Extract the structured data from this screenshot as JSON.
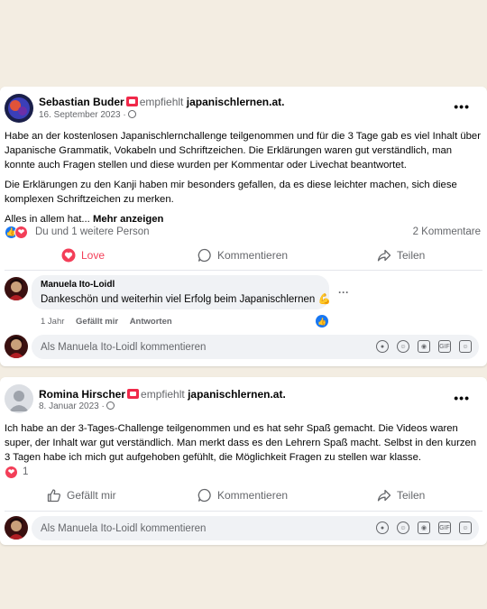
{
  "post1": {
    "author": "Sebastian Buder",
    "recommends": "empfiehlt",
    "page": "japanischlernen.at.",
    "date": "16. September 2023 ·",
    "paragraph1": "Habe an der kostenlosen Japanischlernchallenge teilgenommen und für die 3 Tage gab es viel Inhalt über Japanische Grammatik, Vokabeln und Schriftzeichen. Die Erklärungen waren gut verständlich, man konnte auch Fragen stellen und diese wurden per Kommentar oder Livechat beantwortet.",
    "paragraph2": "Die Erklärungen zu den Kanji haben mir besonders gefallen, da es diese leichter machen, sich diese komplexen Schriftzeichen zu merken.",
    "paragraph3": "Alles in allem hat...",
    "see_more": "Mehr anzeigen",
    "reactions_text": "Du und 1 weitere Person",
    "comments_count": "2 Kommentare",
    "actions": {
      "love": "Love",
      "comment": "Kommentieren",
      "share": "Teilen"
    },
    "comment": {
      "author": "Manuela Ito-Loidl",
      "text": "Dankeschön und weiterhin viel Erfolg beim Japanischlernen 💪",
      "time": "1 Jahr",
      "liked": "Gefällt mir",
      "reply": "Antworten",
      "more": "···"
    },
    "comment_placeholder": "Als Manuela Ito-Loidl kommentieren"
  },
  "post2": {
    "author": "Romina Hirscher",
    "recommends": "empfiehlt",
    "page": "japanischlernen.at.",
    "date": "8. Januar 2023 ·",
    "paragraph1": "Ich habe an der 3-Tages-Challenge teilgenommen und es hat sehr Spaß gemacht. Die Videos waren super, der Inhalt war gut verständlich. Man merkt dass es den Lehrern Spaß macht. Selbst in den kurzen 3 Tagen habe ich mich gut aufgehoben gefühlt, die Möglichkeit Fragen zu stellen war klasse.",
    "reaction_count": "1",
    "actions": {
      "like": "Gefällt mir",
      "comment": "Kommentieren",
      "share": "Teilen"
    },
    "comment_placeholder": "Als Manuela Ito-Loidl kommentieren"
  },
  "more_menu": "•••",
  "input_icons": [
    "avatar-sticker-icon",
    "emoji-icon",
    "camera-icon",
    "gif-icon",
    "sticker-icon"
  ],
  "input_icon_labels": {
    "gif": "GIF"
  },
  "colors": {
    "accent": "#1877f2",
    "love": "#f33e58",
    "background": "#f3ede2"
  }
}
